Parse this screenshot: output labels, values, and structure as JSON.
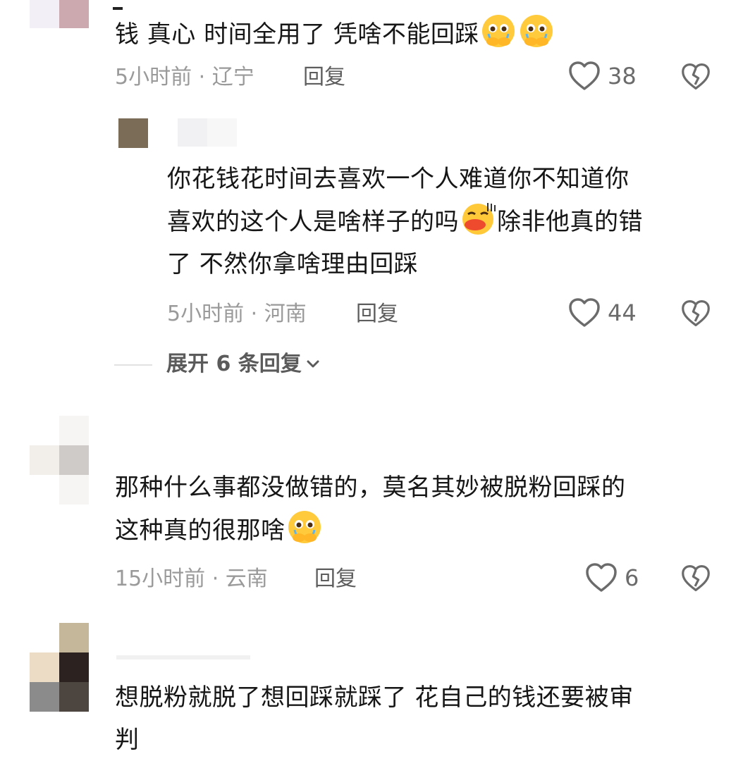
{
  "comments": [
    {
      "text": "钱 真心 时间全用了 凭啥不能回踩",
      "emojis": [
        "crying-pleading-emoji",
        "crying-pleading-emoji"
      ],
      "time": "5小时前",
      "location": "辽宁",
      "reply_label": "回复",
      "likes": "38"
    },
    {
      "text_line1": "你花钱花时间去喜欢一个人难道你不知道你",
      "text_line2a": "喜欢的这个人是啥样子的吗",
      "text_line2b": "除非他真的错",
      "text_line3": "了 不然你拿啥理由回踩",
      "emojis": [
        "pouting-lips-emoji"
      ],
      "time": "5小时前",
      "location": "河南",
      "reply_label": "回复",
      "likes": "44"
    },
    {
      "text_line1": "那种什么事都没做错的，莫名其妙被脱粉回踩的",
      "text_line2": "这种真的很那啥",
      "emojis": [
        "crying-pleading-emoji"
      ],
      "time": "15小时前",
      "location": "云南",
      "reply_label": "回复",
      "likes": "6"
    },
    {
      "text_line1": "想脱粉就脱了想回踩就踩了 花自己的钱还要被审",
      "text_line2": "判"
    }
  ],
  "expand": {
    "label": "展开 6 条回复"
  },
  "separator": " · ",
  "icons": {
    "like": "heart-outline-icon",
    "dislike": "broken-heart-icon",
    "expand": "chevron-down-icon"
  },
  "colors": {
    "text": "#161616",
    "meta": "#9a9a9a",
    "icon": "#6b6b6b"
  }
}
